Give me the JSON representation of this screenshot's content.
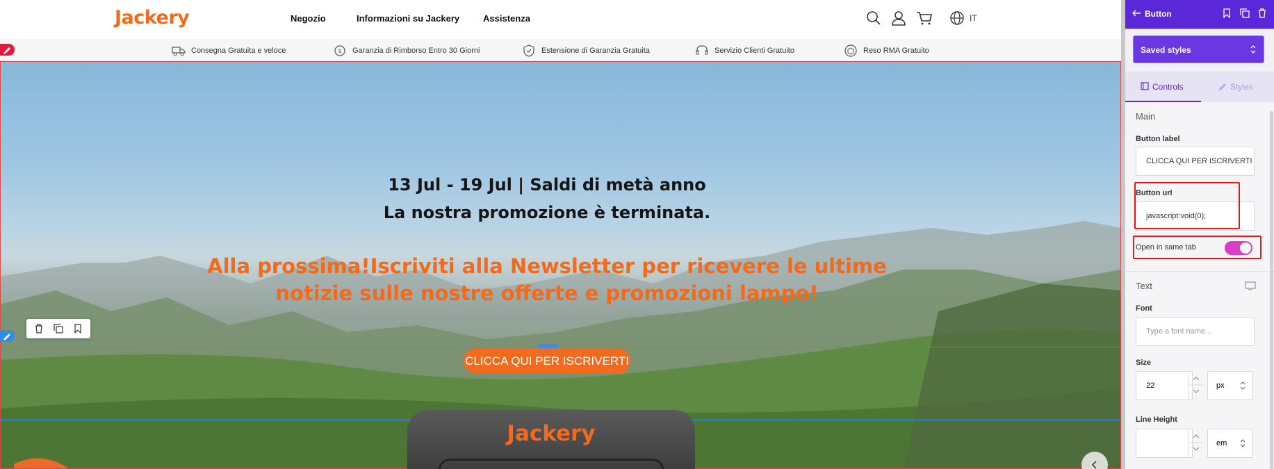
{
  "header": {
    "logo": "Jackery",
    "nav": [
      "Negozio",
      "Informazioni su Jackery",
      "Assistenza"
    ],
    "icons": [
      "search-icon",
      "user-icon",
      "cart-icon",
      "globe-icon"
    ],
    "language": "IT"
  },
  "benefits": [
    {
      "icon": "truck-icon",
      "label": "Consegna Gratuita e veloce"
    },
    {
      "icon": "refund-icon",
      "label": "Garanzia di Rimborso Entro 30 Giorni"
    },
    {
      "icon": "shield-icon",
      "label": "Estensione di Garanzia Gratuita"
    },
    {
      "icon": "headset-icon",
      "label": "Servizio Clienti Gratuito"
    },
    {
      "icon": "box-icon",
      "label": "Reso RMA Gratuito"
    }
  ],
  "hero": {
    "line1": "13 Jul - 19 Jul | Saldi di metà anno",
    "line2": "La nostra promozione è terminata.",
    "promo1": "Alla prossima!Iscriviti alla Newsletter per ricevere le ultime",
    "promo2": "notizie sulle nostre offerte e promozioni lampo!",
    "cta": "CLICCA QUI PER ISCRIVERTI",
    "device_logo": "Jackery"
  },
  "panel": {
    "title": "Button",
    "saved_styles": "Saved styles",
    "tabs": {
      "controls": "Controls",
      "styles": "Styles"
    },
    "main_section": "Main",
    "button_label": {
      "label": "Button label",
      "value": "CLICCA QUI PER ISCRIVERTI"
    },
    "button_url": {
      "label": "Button url",
      "value": "javascript:void(0);"
    },
    "open_same_tab": {
      "label": "Open in same tab",
      "on": true
    },
    "text_section": "Text",
    "font": {
      "label": "Font",
      "placeholder": "Type a font name..."
    },
    "size": {
      "label": "Size",
      "value": "22",
      "unit": "px"
    },
    "line_height": {
      "label": "Line Height",
      "value": "",
      "unit": "em"
    }
  },
  "colors": {
    "brand": "#f26b1d",
    "panel_accent": "#5b28d9",
    "highlight": "#e21a1a",
    "toggle": "#d83fc4"
  }
}
